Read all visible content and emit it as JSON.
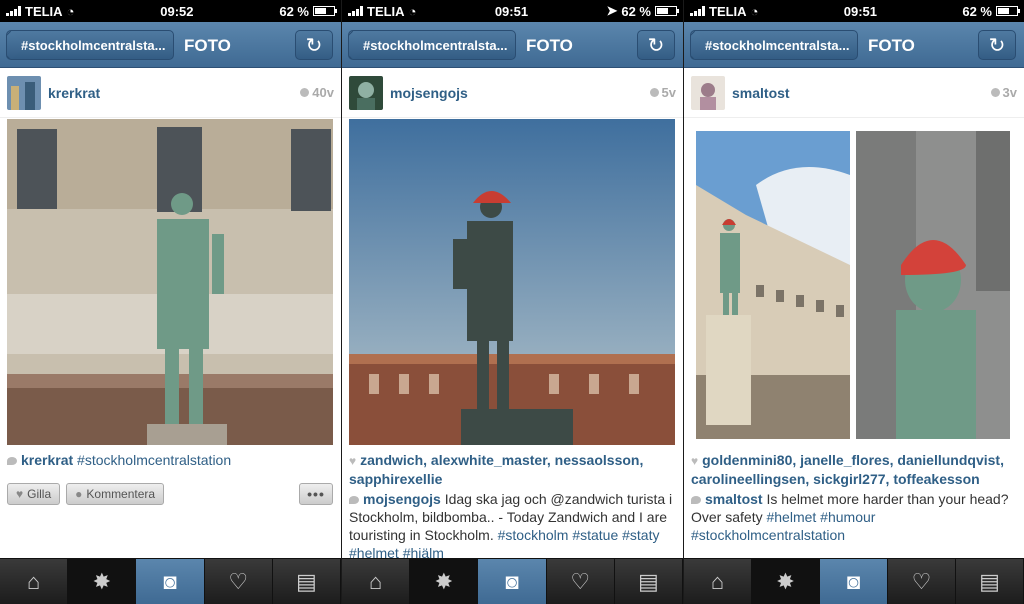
{
  "panels": [
    {
      "status": {
        "carrier": "TELIA",
        "time": "09:52",
        "battery": "62 %",
        "battery_level": 0.62
      },
      "nav": {
        "back": "#stockholmcentralsta...",
        "title": "FOTO"
      },
      "post": {
        "username": "krerkrat",
        "time": "40v",
        "caption_user": "krerkrat",
        "caption_tag": "#stockholmcentralstation",
        "like_button": "Gilla",
        "comment_button": "Kommentera",
        "more_button": "•••"
      }
    },
    {
      "status": {
        "carrier": "TELIA",
        "time": "09:51",
        "battery": "62 %",
        "battery_level": 0.62
      },
      "nav": {
        "back": "#stockholmcentralsta...",
        "title": "FOTO"
      },
      "post": {
        "username": "mojsengojs",
        "time": "5v",
        "likes": "zandwich, alexwhite_master, nessaolsson, sapphirexellie",
        "caption_user": "mojsengojs",
        "caption_text": "Idag ska jag och @zandwich turista i Stockholm, bildbomba.. - Today Zandwich and I are touristing in Stockholm.",
        "caption_tags": "#stockholm #statue #staty #helmet #hjälm"
      }
    },
    {
      "status": {
        "carrier": "TELIA",
        "time": "09:51",
        "battery": "62 %",
        "battery_level": 0.62
      },
      "nav": {
        "back": "#stockholmcentralsta...",
        "title": "FOTO"
      },
      "post": {
        "username": "smaltost",
        "time": "3v",
        "likes": "goldenmini80, janelle_flores, daniellundqvist, carolineellingsen, sickgirl277, toffeakesson",
        "caption_user": "smaltost",
        "caption_text": "Is helmet more harder than your head? Over safety",
        "caption_tags": "#helmet #humour #stockholmcentralstation"
      }
    }
  ],
  "tabbar": {
    "icons": [
      "home-icon",
      "explore-icon",
      "camera-icon",
      "news-icon",
      "profile-icon"
    ]
  },
  "colors": {
    "nav": "#4a76a0",
    "link": "#2f5f86",
    "tab_active": "#4a76a0"
  }
}
